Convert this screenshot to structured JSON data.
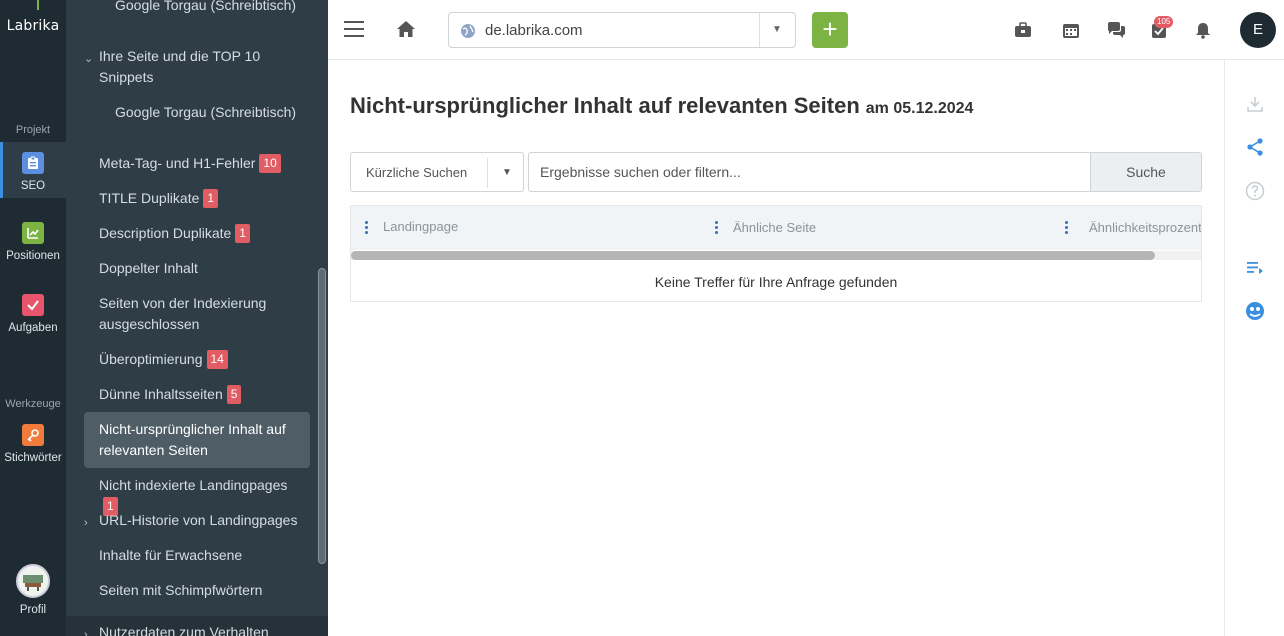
{
  "app": {
    "logo_text": "Labrika"
  },
  "rail": {
    "section_project": "Projekt",
    "section_tools": "Werkzeuge",
    "items": [
      {
        "label": "SEO",
        "icon": "clipboard-icon",
        "active": true
      },
      {
        "label": "Positionen",
        "icon": "chart-icon"
      },
      {
        "label": "Aufgaben",
        "icon": "check-icon"
      },
      {
        "label": "Stichwörter",
        "icon": "key-icon"
      },
      {
        "label": "Profil",
        "icon": "avatar"
      }
    ]
  },
  "submenu": {
    "items": [
      {
        "label": "Google Torgau (Schreibtisch)"
      },
      {
        "label": "Ihre Seite und die TOP 10 Snippets"
      },
      {
        "label": "Google Torgau (Schreibtisch)"
      },
      {
        "label": "Meta-Tag- und H1-Fehler",
        "badge": "10"
      },
      {
        "label": "TITLE Duplikate",
        "badge": "1"
      },
      {
        "label": "Description Duplikate",
        "badge": "1"
      },
      {
        "label": "Doppelter Inhalt"
      },
      {
        "label": "Seiten von der Indexierung ausgeschlossen"
      },
      {
        "label": "Überoptimierung",
        "badge": "14"
      },
      {
        "label": "Dünne Inhaltsseiten",
        "badge": "5"
      },
      {
        "label": "Nicht-ursprünglicher Inhalt auf relevanten Seiten",
        "active": true
      },
      {
        "label": "Nicht indexierte Landingpages",
        "badge": "1"
      },
      {
        "label": "URL-Historie von Landingpages"
      },
      {
        "label": "Inhalte für Erwachsene"
      },
      {
        "label": "Seiten mit Schimpfwörtern"
      },
      {
        "label": "Nutzerdaten zum Verhalten"
      }
    ]
  },
  "topbar": {
    "domain": "de.labrika.com",
    "add_label": "+",
    "notification_count": "105",
    "user_initial": "E"
  },
  "main": {
    "title": "Nicht-ursprünglicher Inhalt auf relevanten Seiten",
    "date": "am 05.12.2024",
    "recent_searches": "Kürzliche Suchen",
    "search_placeholder": "Ergebnisse suchen oder filtern...",
    "search_button": "Suche",
    "table": {
      "columns": [
        "Landingpage",
        "Ähnliche Seite",
        "Ähnlichkeitsprozentsatz"
      ],
      "empty_text": "Keine Treffer für Ihre Anfrage gefunden"
    }
  },
  "colors": {
    "rail_bg": "#1f2b33",
    "panel_bg": "#2f3d47",
    "accent_green": "#7cb342",
    "badge_red": "#e25c63",
    "link_blue": "#3b8fe0"
  }
}
